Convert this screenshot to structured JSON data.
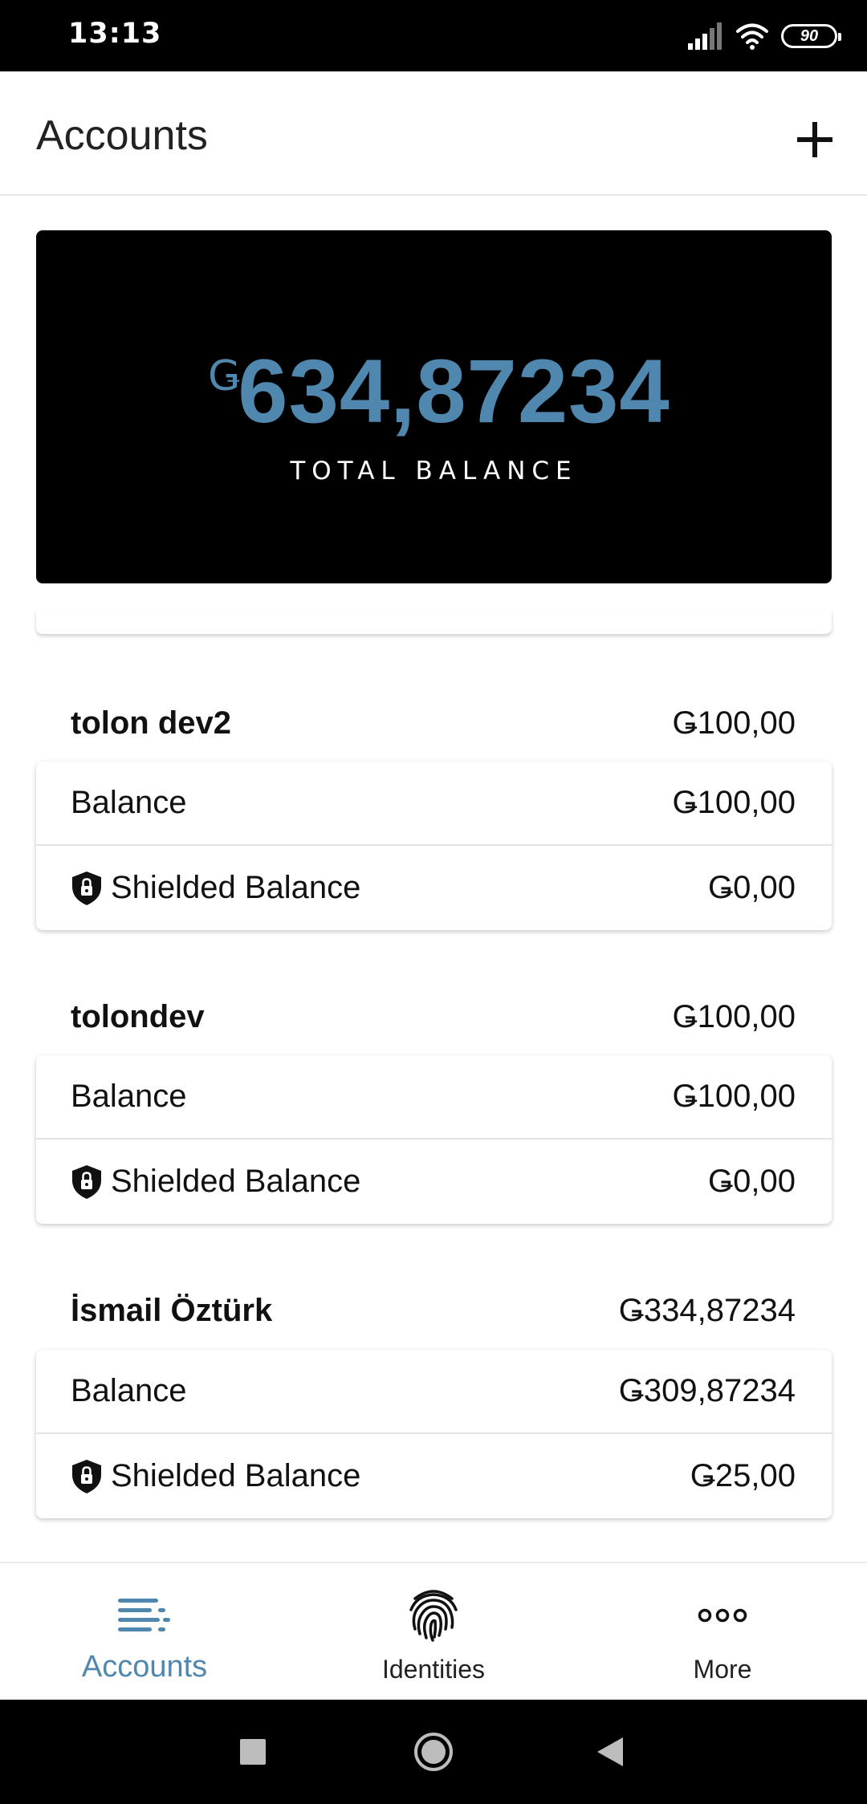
{
  "status_bar": {
    "time": "13:13",
    "battery": "90"
  },
  "header": {
    "title": "Accounts",
    "add_icon": "plus-icon"
  },
  "total": {
    "currency_symbol": "Ǥ",
    "amount": "634,87234",
    "label": "TOTAL BALANCE"
  },
  "accounts": [
    {
      "name": "tolon dev2",
      "total": "Ǥ100,00",
      "balance_label": "Balance",
      "balance": "Ǥ100,00",
      "shielded_label": "Shielded Balance",
      "shielded": "Ǥ0,00"
    },
    {
      "name": "tolondev",
      "total": "Ǥ100,00",
      "balance_label": "Balance",
      "balance": "Ǥ100,00",
      "shielded_label": "Shielded Balance",
      "shielded": "Ǥ0,00"
    },
    {
      "name": "İsmail Öztürk",
      "total": "Ǥ334,87234",
      "balance_label": "Balance",
      "balance": "Ǥ309,87234",
      "shielded_label": "Shielded Balance",
      "shielded": "Ǥ25,00"
    }
  ],
  "nav": {
    "accounts": "Accounts",
    "identities": "Identities",
    "more": "More",
    "active": "accounts"
  },
  "colors": {
    "accent": "#4f87ae",
    "total_card_bg": "#000000"
  }
}
